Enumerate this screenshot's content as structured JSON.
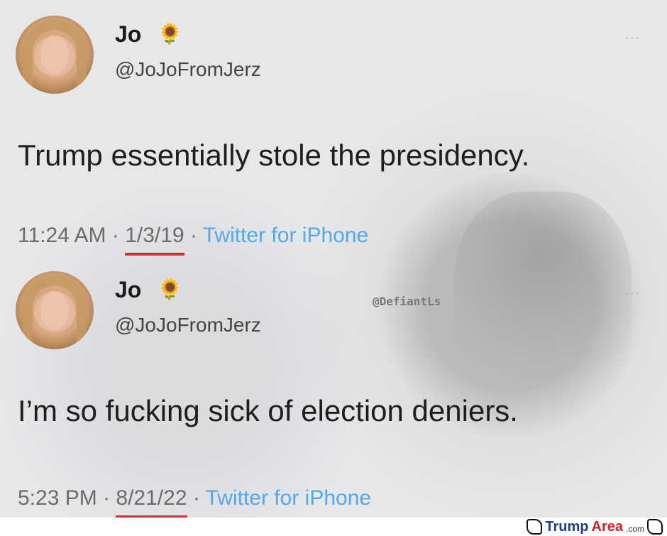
{
  "tweets": [
    {
      "name": "Jo",
      "emoji": "🌻",
      "handle": "@JoJoFromJerz",
      "text": "Trump essentially stole the presidency.",
      "time": "11:24 AM",
      "separator": " · ",
      "date": "1/3/19",
      "source": "Twitter for iPhone"
    },
    {
      "name": "Jo",
      "emoji": "🌻",
      "handle": "@JoJoFromJerz",
      "text": "I’m so fucking sick of election deniers.",
      "time": "5:23 PM",
      "separator": " · ",
      "date": "8/21/22",
      "source": "Twitter for iPhone"
    }
  ],
  "more_glyph": "···",
  "watermark": "@DefiantLs",
  "site": {
    "brand_part1": "Trump",
    "brand_part2": "Area",
    "brand_suffix": ".com"
  },
  "colors": {
    "underline": "#d8283a",
    "source_link": "#56a8e6",
    "brand_blue": "#1b3e8a",
    "brand_red": "#d01f26"
  }
}
